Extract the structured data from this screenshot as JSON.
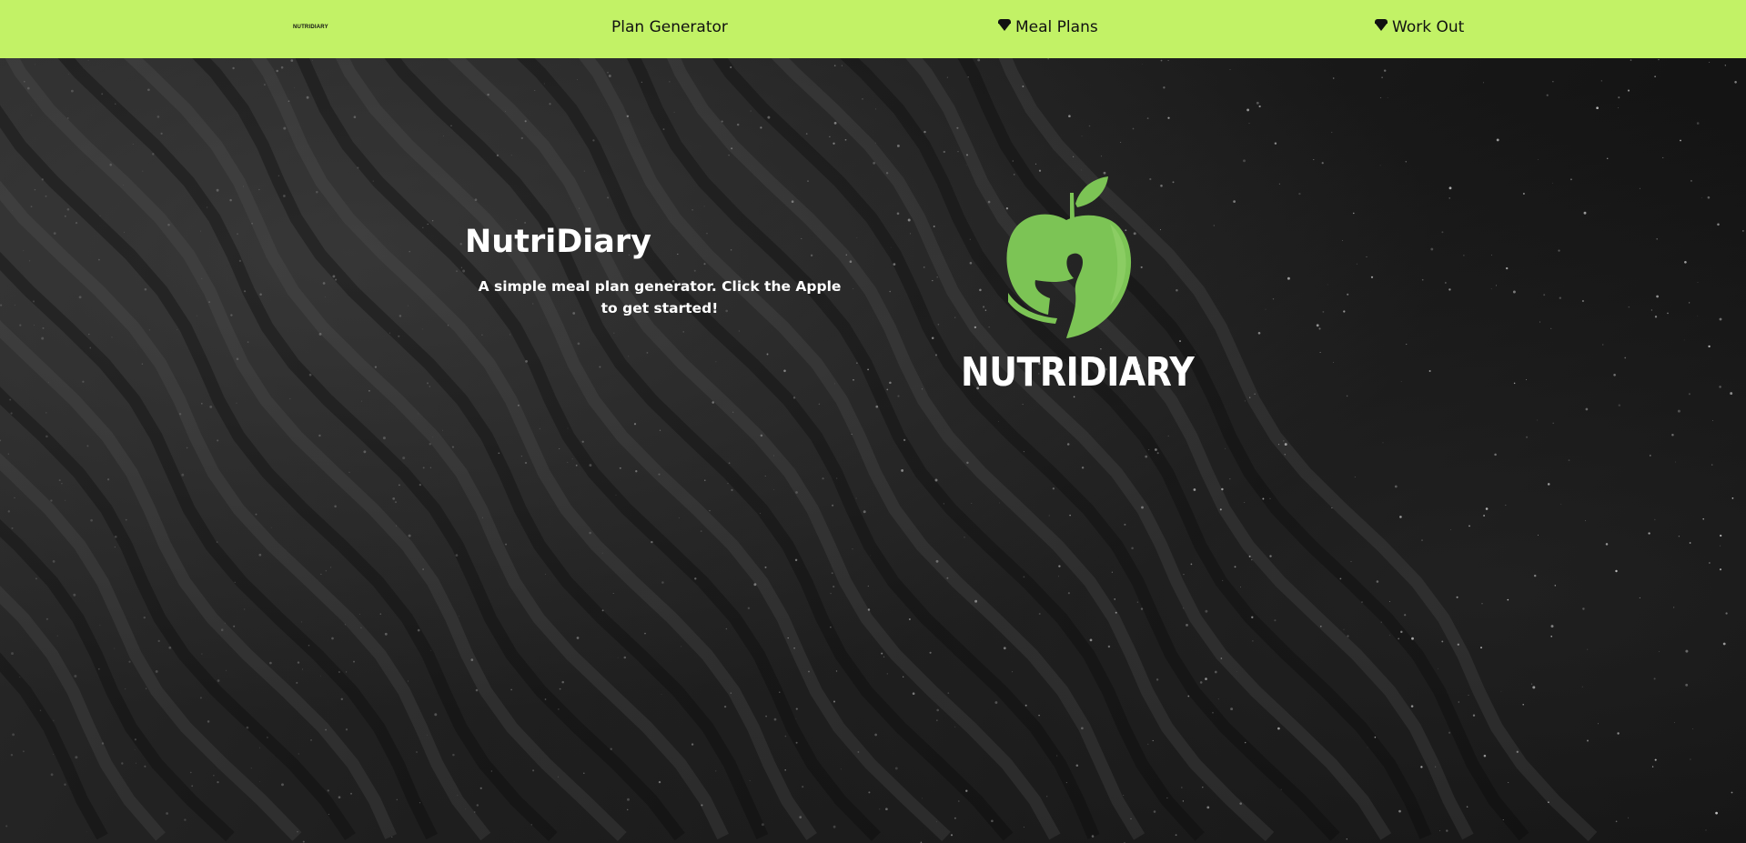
{
  "navbar": {
    "logo_text": "NUTRIDIARY",
    "items": [
      {
        "label": "Plan Generator",
        "icon": null
      },
      {
        "label": "Meal Plans",
        "icon": "heart-dropdown-icon"
      },
      {
        "label": "Work Out",
        "icon": "heart-dropdown-icon"
      }
    ],
    "background_color": "#c2f266"
  },
  "hero": {
    "title": "NutriDiary",
    "subtitle": "A simple meal plan generator. Click the Apple to get started!"
  },
  "logo": {
    "icon": "apple-icon",
    "text": "NUTRIDIARY",
    "apple_color": "#7cc455"
  }
}
